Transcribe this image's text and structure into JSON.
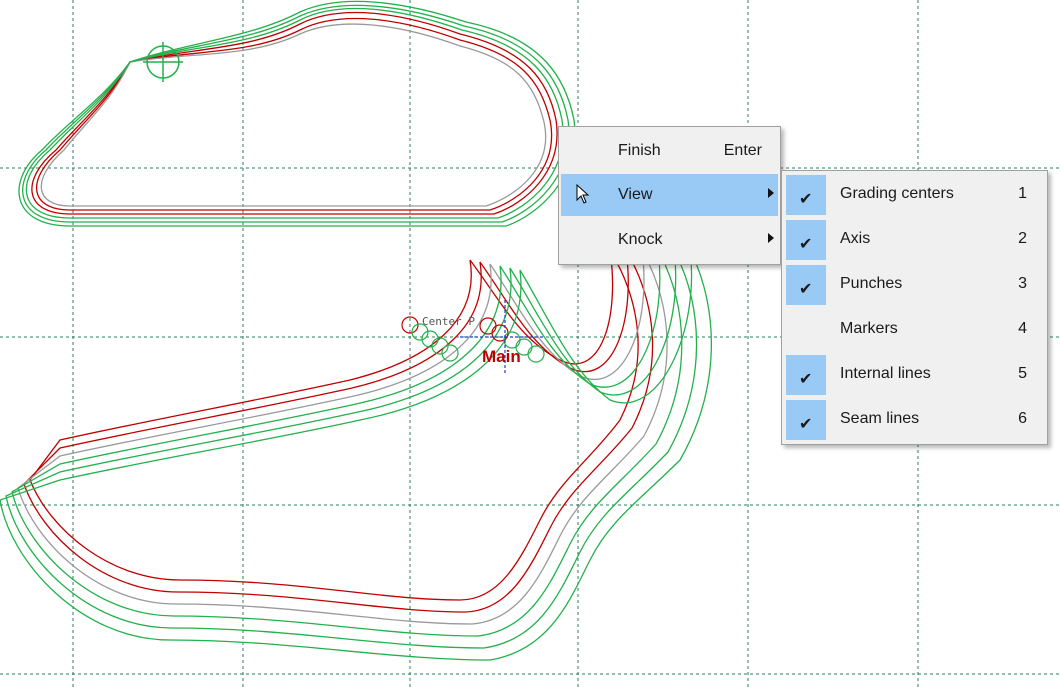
{
  "canvas": {
    "background": "#ffffff",
    "grid_color": "#2e7d5b",
    "colors": {
      "small_sizes": "#c00000",
      "base": "#9a9a9a",
      "large_sizes": "#22b14c"
    },
    "labels": {
      "center": "Center P",
      "main": "Main"
    }
  },
  "context_menu": {
    "items": [
      {
        "label": "Finish",
        "shortcut": "Enter",
        "has_submenu": false,
        "highlighted": false
      },
      {
        "label": "View",
        "shortcut": "",
        "has_submenu": true,
        "highlighted": true
      },
      {
        "label": "Knock",
        "shortcut": "",
        "has_submenu": true,
        "highlighted": false
      }
    ]
  },
  "view_submenu": {
    "items": [
      {
        "label": "Grading centers",
        "number": "1",
        "checked": true
      },
      {
        "label": "Axis",
        "number": "2",
        "checked": true
      },
      {
        "label": "Punches",
        "number": "3",
        "checked": true
      },
      {
        "label": "Markers",
        "number": "4",
        "checked": false
      },
      {
        "label": "Internal lines",
        "number": "5",
        "checked": true
      },
      {
        "label": "Seam lines",
        "number": "6",
        "checked": true
      }
    ],
    "check_glyph": "✔",
    "highlight_color": "#99c9f5"
  }
}
